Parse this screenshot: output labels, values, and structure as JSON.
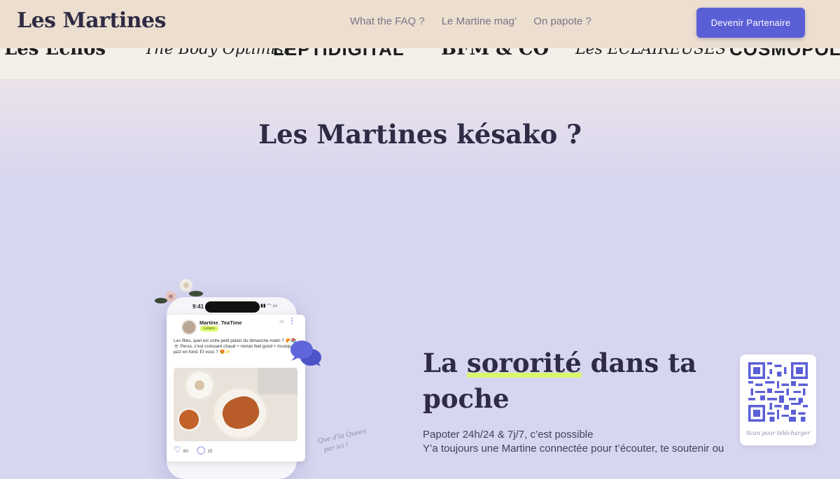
{
  "header": {
    "logo": "Les Martines",
    "nav": [
      {
        "label": "What the FAQ ?"
      },
      {
        "label": "Le Martine mag’"
      },
      {
        "label": "On papote ?"
      }
    ],
    "cta_label": "Devenir Partenaire"
  },
  "press": [
    "Les Echos",
    "The Body Optimist",
    "LEPTIDIGITAL",
    "BFM & CO",
    "Les ÉCLAIREUSES",
    "COSMOPOLITAN"
  ],
  "kesako": {
    "prefix": "Les Martines ",
    "highlight": "késako",
    "suffix": " ?"
  },
  "post": {
    "time": "9:41",
    "username": "Martine_TeaTime",
    "tag": "Loisirs",
    "age": "2h",
    "text": "Les filles, quel est votre petit plaisir du dimanche matin ? 🥐📚☕ Perso, c’est croissant chaud + roman feel good + musique jazz en fond. Et vous ? 😍✨",
    "likes": "80",
    "comments": "15"
  },
  "queen_note": [
    "Que d’la Queen",
    "par ici !"
  ],
  "sorority": {
    "highlight": "sororité",
    "prefix": "La ",
    "suffix": " dans ta",
    "line2": "poche"
  },
  "body": {
    "line1": "Papoter 24h/24 & 7j/7, c’est possible",
    "line2": "Y’a toujours une Martine connectée pour t’écouter, te soutenir ou"
  },
  "qr_caption": "Scan pour télécharger",
  "colors": {
    "accent": "#5b5fd6",
    "highlight": "#d9f76a",
    "text": "#2f2b44"
  }
}
